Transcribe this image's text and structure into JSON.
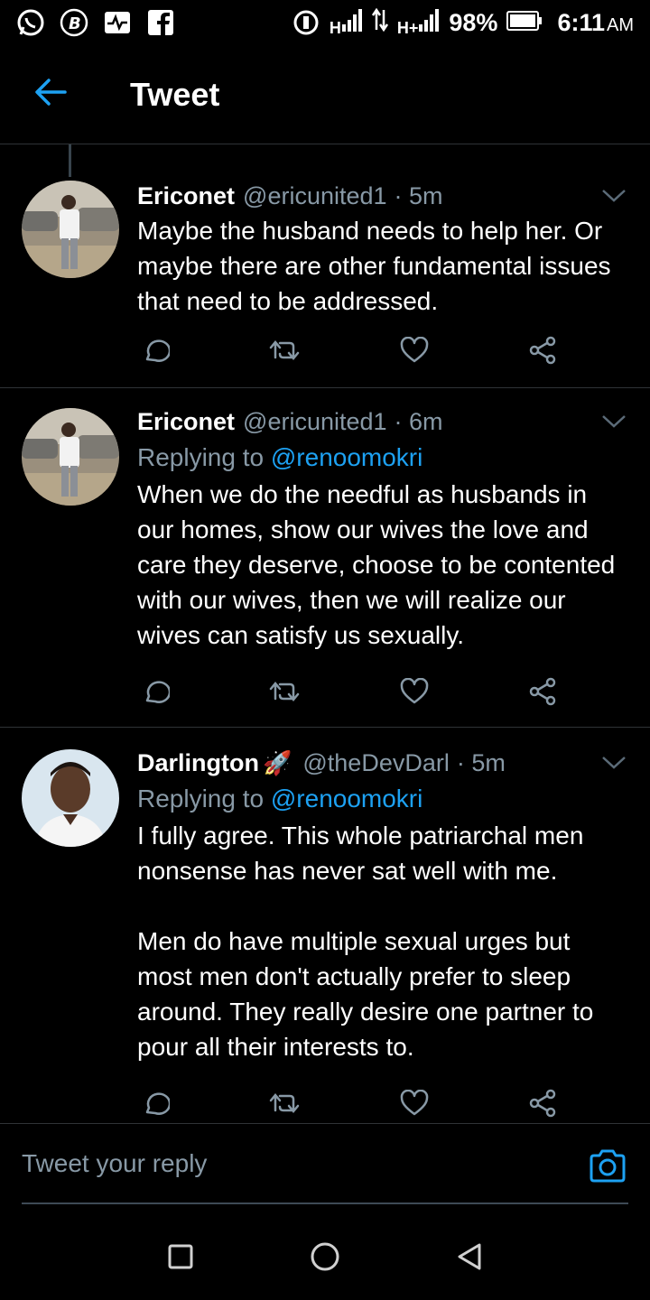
{
  "status_bar": {
    "battery": "98%",
    "time": "6:11",
    "ampm": "AM",
    "network_h": "H",
    "network_hplus": "H+",
    "icons": [
      "whatsapp-icon",
      "b-icon",
      "activity-icon",
      "facebook-icon",
      "hotspot-icon",
      "signal-icon",
      "data-arrows-icon",
      "signal-icon",
      "battery-icon"
    ]
  },
  "header": {
    "title": "Tweet"
  },
  "tweets": [
    {
      "name": "Ericonet",
      "handle": "@ericunited1",
      "time": "· 5m",
      "replying_label": "",
      "replying_to": "",
      "text": "Maybe the husband needs to help her. Or maybe there are other fundamental issues that need to be addressed."
    },
    {
      "name": "Ericonet",
      "handle": "@ericunited1",
      "time": "· 6m",
      "replying_label": "Replying to",
      "replying_to": "@renoomokri",
      "text": "When we do the needful as husbands in our homes, show our wives the love and care they deserve, choose to be contented with our wives, then we will realize our wives can satisfy us sexually."
    },
    {
      "name": "Darlington",
      "name_emoji": "🚀",
      "handle": "@theDevDarl",
      "time": "· 5m",
      "replying_label": "Replying to",
      "replying_to": "@renoomokri",
      "text": "I fully agree. This whole patriarchal men nonsense has never sat well with me.\n\nMen do have multiple sexual urges but most men don't actually prefer to sleep around. They really desire one partner to pour all their interests to."
    }
  ],
  "reply_bar": {
    "placeholder": "Tweet your reply"
  },
  "colors": {
    "background": "#000000",
    "accent": "#1da1f2",
    "secondary_text": "#8899a6",
    "divider": "#2f3336"
  }
}
